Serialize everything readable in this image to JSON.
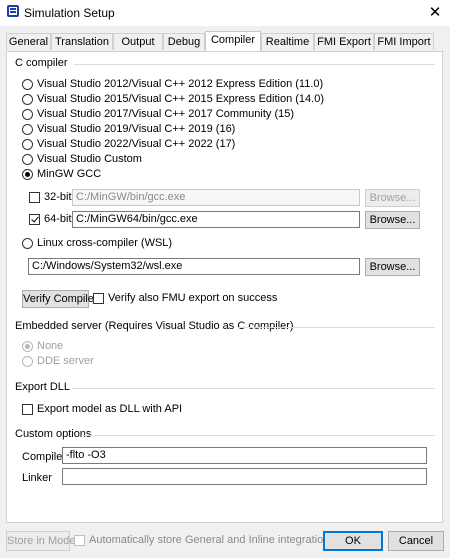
{
  "window": {
    "title": "Simulation Setup",
    "close_glyph": "✕"
  },
  "tabs": [
    {
      "label": "General",
      "active": false
    },
    {
      "label": "Translation",
      "active": false
    },
    {
      "label": "Output",
      "active": false
    },
    {
      "label": "Debug",
      "active": false
    },
    {
      "label": "Compiler",
      "active": true
    },
    {
      "label": "Realtime",
      "active": false
    },
    {
      "label": "FMI Export",
      "active": false
    },
    {
      "label": "FMI Import",
      "active": false
    }
  ],
  "c_compiler": {
    "section_label": "C compiler",
    "options": [
      {
        "label": "Visual Studio 2012/Visual C++ 2012 Express Edition (11.0)",
        "selected": false
      },
      {
        "label": "Visual Studio 2015/Visual C++ 2015 Express Edition (14.0)",
        "selected": false
      },
      {
        "label": "Visual Studio 2017/Visual C++ 2017 Community (15)",
        "selected": false
      },
      {
        "label": "Visual Studio 2019/Visual C++ 2019 (16)",
        "selected": false
      },
      {
        "label": "Visual Studio 2022/Visual C++ 2022 (17)",
        "selected": false
      },
      {
        "label": "Visual Studio Custom",
        "selected": false
      },
      {
        "label": "MinGW GCC",
        "selected": true
      }
    ],
    "mingw_32": {
      "label": "32-bit:",
      "checked": false,
      "path": "C:/MinGW/bin/gcc.exe",
      "browse_label": "Browse...",
      "enabled": false
    },
    "mingw_64": {
      "label": "64-bit:",
      "checked": true,
      "path": "C:/MinGW64/bin/gcc.exe",
      "browse_label": "Browse...",
      "enabled": true
    },
    "linux": {
      "label": "Linux cross-compiler (WSL)",
      "selected": false,
      "path": "C:/Windows/System32/wsl.exe",
      "browse_label": "Browse..."
    },
    "verify_button_label": "Verify Compiler",
    "verify_fmu_label": "Verify also FMU export on success",
    "verify_fmu_checked": false
  },
  "embedded_server": {
    "section_label": "Embedded server (Requires Visual Studio as C compiler)",
    "options": [
      {
        "label": "None",
        "selected": true
      },
      {
        "label": "DDE server",
        "selected": false
      }
    ]
  },
  "export_dll": {
    "section_label": "Export DLL",
    "checkbox_label": "Export model as DLL with API",
    "checked": false
  },
  "custom_options": {
    "section_label": "Custom options",
    "compiler_label": "Compiler",
    "compiler_value": "-flto -O3",
    "linker_label": "Linker",
    "linker_value": ""
  },
  "footer": {
    "store_label": "Store in Model",
    "auto_store_label": "Automatically store General and Inline integration settings",
    "auto_store_checked": false,
    "ok_label": "OK",
    "cancel_label": "Cancel"
  }
}
